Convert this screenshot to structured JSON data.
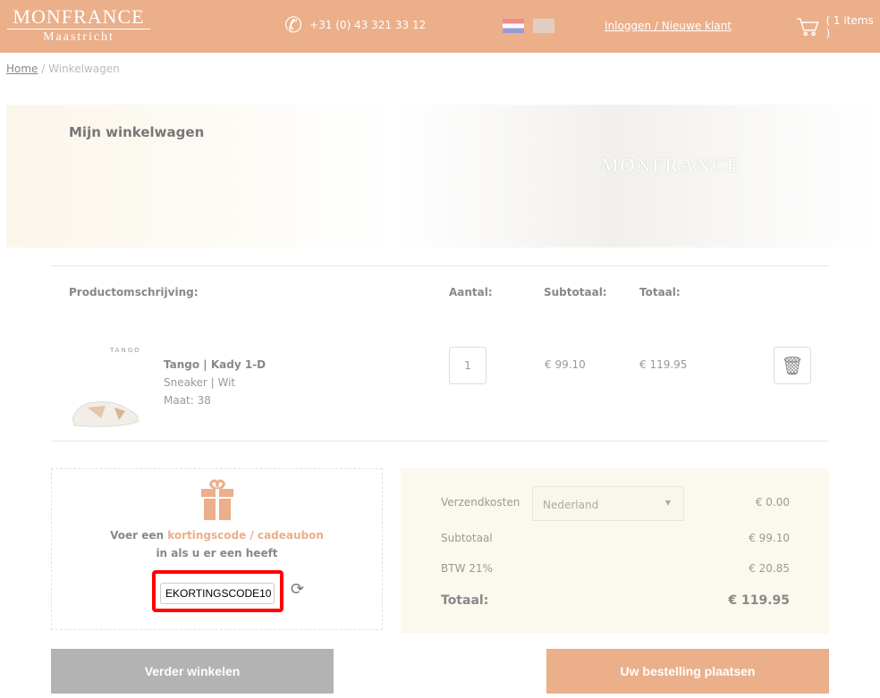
{
  "header": {
    "logo_line1": "MONFRANCE",
    "logo_line2": "Maastricht",
    "phone": "+31 (0) 43 321 33 12",
    "login": "Inloggen / Nieuwe klant",
    "cart": "( 1 items )"
  },
  "breadcrumb": {
    "home": "Home",
    "separator": "/",
    "current": "Winkelwagen"
  },
  "banner": {
    "title": "Mijn winkelwagen",
    "watermark": "MONFRANCE"
  },
  "table": {
    "headers": [
      "Productomschrijving:",
      "Aantal:",
      "Subtotaal:",
      "Totaal:"
    ]
  },
  "item": {
    "brand": "TANGO",
    "name": "Tango | Kady 1-D",
    "type": "Sneaker | Wit",
    "size": "Maat: 38",
    "quantity": "1",
    "subtotal": "€ 99.10",
    "total": "€ 119.95"
  },
  "coupon": {
    "text1": "Voer een ",
    "highlight": "kortingscode / cadeaubon",
    "text2": "in als u er een heeft",
    "code": "EKORTINGSCODE10"
  },
  "summary": {
    "shipping_label": "Verzendkosten",
    "country": "Nederland",
    "shipping": "€ 0.00",
    "subtotal_label": "Subtotaal",
    "subtotal": "€ 99.10",
    "vat_label": "BTW 21%",
    "vat": "€ 20.85",
    "total_label": "Totaal:",
    "total": "€ 119.95"
  },
  "buttons": {
    "continue": "Verder winkelen",
    "order": "Uw bestelling plaatsen"
  },
  "colors": {
    "accent": "#ebaf8a",
    "highlight_box": "#ff0000",
    "continue_button": "#b3b3b3"
  }
}
